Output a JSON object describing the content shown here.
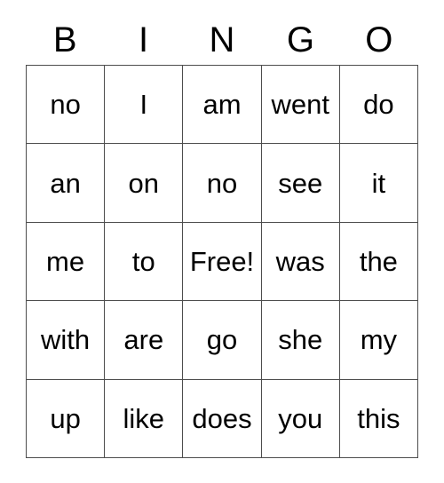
{
  "card": {
    "title": "BINGO",
    "headers": [
      "B",
      "I",
      "N",
      "G",
      "O"
    ],
    "free_space_label": "Free!",
    "free_space_position": {
      "row": 2,
      "col": 2
    },
    "rows": [
      [
        "no",
        "I",
        "am",
        "went",
        "do"
      ],
      [
        "an",
        "on",
        "no",
        "see",
        "it"
      ],
      [
        "me",
        "to",
        "Free!",
        "was",
        "the"
      ],
      [
        "with",
        "are",
        "go",
        "she",
        "my"
      ],
      [
        "up",
        "like",
        "does",
        "you",
        "this"
      ]
    ]
  },
  "style": {
    "background": "#ffffff",
    "text_color": "#000000",
    "border_color": "#4d4d4d"
  }
}
